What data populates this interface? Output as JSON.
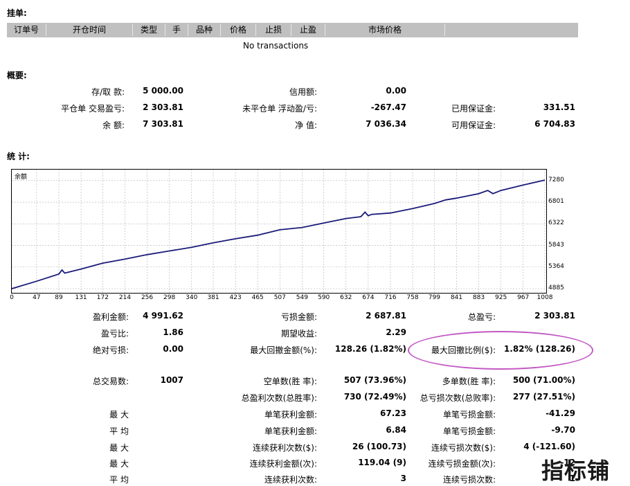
{
  "pending": {
    "title": "挂单:",
    "columns": [
      "订单号",
      "开仓时间",
      "类型",
      "手",
      "品种",
      "价格",
      "止损",
      "止盈",
      "市场价格"
    ],
    "empty_text": "No transactions"
  },
  "summary": {
    "title": "概要:",
    "rows": [
      {
        "l1": "存/取 款:",
        "v1": "5 000.00",
        "l2": "信用额:",
        "v2": "0.00",
        "l3": "",
        "v3": ""
      },
      {
        "l1": "平仓单 交易盈亏:",
        "v1": "2 303.81",
        "l2": "未平仓单 浮动盈/亏:",
        "v2": "-267.47",
        "l3": "已用保证金:",
        "v3": "331.51"
      },
      {
        "l1": "余 额:",
        "v1": "7 303.81",
        "l2": "净 值:",
        "v2": "7 036.34",
        "l3": "可用保证金:",
        "v3": "6 704.83"
      }
    ]
  },
  "stats": {
    "title": "统 计:",
    "rows": [
      {
        "l1": "盈利金额:",
        "v1": "4 991.62",
        "l2": "亏损金额:",
        "v2": "2 687.81",
        "l3": "总盈亏:",
        "v3": "2 303.81"
      },
      {
        "l1": "盈亏比:",
        "v1": "1.86",
        "l2": "期望收益:",
        "v2": "2.29",
        "l3": "",
        "v3": ""
      },
      {
        "l1": "绝对亏损:",
        "v1": "0.00",
        "l2": "最大回撤金额(%):",
        "v2": "128.26 (1.82%)",
        "l3": "最大回撤比例($):",
        "v3": "1.82% (128.26)"
      },
      {
        "l1": "总交易数:",
        "v1": "1007",
        "l2": "空单数(胜 率):",
        "v2": "507 (73.96%)",
        "l3": "多单数(胜 率):",
        "v3": "500 (71.00%)"
      },
      {
        "l1": "",
        "v1": "",
        "l2": "总盈利次数(总胜率):",
        "v2": "730 (72.49%)",
        "l3": "总亏损次数(总败率):",
        "v3": "277 (27.51%)"
      },
      {
        "l1": "最 大",
        "v1": "",
        "l2": "单笔获利金额:",
        "v2": "67.23",
        "l3": "单笔亏损金额:",
        "v3": "-41.29"
      },
      {
        "l1": "平 均",
        "v1": "",
        "l2": "单笔获利金额:",
        "v2": "6.84",
        "l3": "单笔亏损金额:",
        "v3": "-9.70"
      },
      {
        "l1": "最 大",
        "v1": "",
        "l2": "连续获利次数($):",
        "v2": "26 (100.73)",
        "l3": "连续亏损次数($):",
        "v3": "4 (-121.60)"
      },
      {
        "l1": "最 大",
        "v1": "",
        "l2": "连续获利金额(次):",
        "v2": "119.04 (9)",
        "l3": "连续亏损金额(次):",
        "v3": "-12"
      },
      {
        "l1": "平 均",
        "v1": "",
        "l2": "连续获利次数:",
        "v2": "3",
        "l3": "连续亏损次数:",
        "v3": "1"
      }
    ]
  },
  "chart_data": {
    "type": "line",
    "title": "余额",
    "xlabel": "",
    "ylabel": "",
    "x_ticks": [
      0,
      47,
      89,
      131,
      172,
      214,
      256,
      298,
      340,
      381,
      423,
      465,
      507,
      549,
      590,
      632,
      674,
      716,
      758,
      799,
      841,
      883,
      925,
      967,
      1008
    ],
    "y_ticks": [
      4885,
      5364,
      5843,
      6322,
      6801,
      7280
    ],
    "xlim": [
      0,
      1008
    ],
    "ylim": [
      4885,
      7430
    ],
    "grid": true,
    "series": [
      {
        "name": "",
        "x": [
          0,
          47,
          89,
          95,
          100,
          131,
          172,
          214,
          256,
          298,
          340,
          381,
          423,
          465,
          507,
          549,
          590,
          632,
          660,
          668,
          674,
          680,
          716,
          758,
          799,
          820,
          841,
          883,
          900,
          910,
          925,
          967,
          1008
        ],
        "y": [
          4885,
          5050,
          5210,
          5300,
          5230,
          5320,
          5450,
          5540,
          5640,
          5720,
          5800,
          5900,
          5990,
          6070,
          6190,
          6240,
          6340,
          6440,
          6480,
          6580,
          6500,
          6530,
          6560,
          6660,
          6770,
          6850,
          6890,
          6990,
          7060,
          6990,
          7060,
          7180,
          7290
        ]
      }
    ],
    "colors": {
      "line": "#1a1a7a",
      "grid": "#b0b0b0"
    }
  },
  "watermark": "指标铺"
}
